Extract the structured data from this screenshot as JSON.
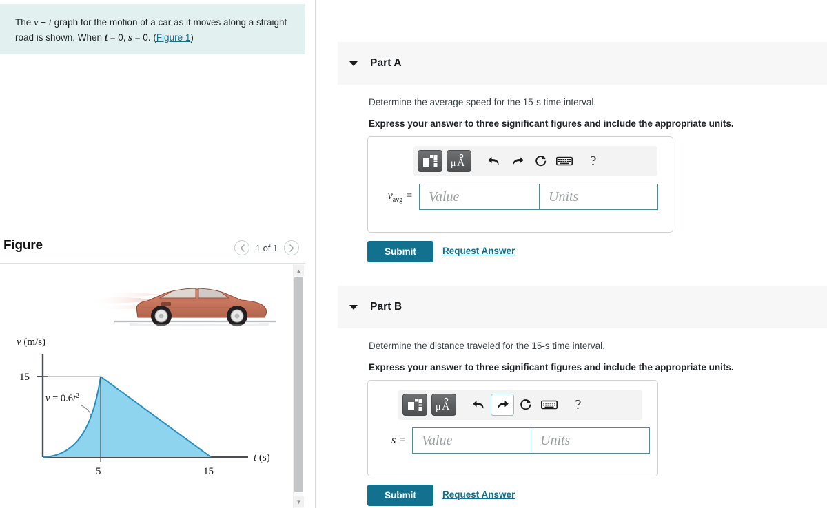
{
  "problem": {
    "text_pre": "The ",
    "v": "v",
    "dash": " − ",
    "t": "t",
    "text_mid": " graph for the motion of a car as it moves along a straight road is shown. When ",
    "t2": "t",
    "eq0a": " = 0, ",
    "s": "s",
    "eq0b": " = 0. ",
    "figure_link": "Figure 1",
    "full": "The v − t graph for the motion of a car as it moves along a straight road is shown. When t = 0, s = 0. (Figure 1)",
    "bg_color": "#e2f0ef",
    "link_color": "#1b6d8c"
  },
  "figure": {
    "title": "Figure",
    "count_label": "1 of 1",
    "prev_icon": "chevron-left-icon",
    "next_icon": "chevron-right-icon",
    "scroll_up_icon": "triangle-up-icon",
    "scroll_down_icon": "triangle-down-icon",
    "car_illustration": "red-sports-car-with-motion-blur"
  },
  "chart_data": {
    "type": "area",
    "title": "",
    "xlabel": "t (s)",
    "ylabel": "v (m/s)",
    "annotation": "v = 0.6t²",
    "xlim": [
      0,
      18
    ],
    "ylim": [
      0,
      18
    ],
    "xticks": [
      5,
      15
    ],
    "xtick_labels": [
      "5",
      "15"
    ],
    "yticks": [
      15
    ],
    "ytick_labels": [
      "15"
    ],
    "grid": false,
    "legend": null,
    "fill_color": "#8ed4ef",
    "line_color": "#2a8fbd",
    "segments": [
      {
        "name": "parabolic rise",
        "equation": "v = 0.6t^2",
        "t_from": 0,
        "t_to": 5,
        "v_from": 0,
        "v_to": 15
      },
      {
        "name": "linear fall",
        "equation": "v = 22.5 - 1.5t",
        "t_from": 5,
        "t_to": 15,
        "v_from": 15,
        "v_to": 0
      }
    ],
    "points": [
      {
        "t": 0,
        "v": 0
      },
      {
        "t": 1,
        "v": 0.6
      },
      {
        "t": 2,
        "v": 2.4
      },
      {
        "t": 3,
        "v": 5.4
      },
      {
        "t": 4,
        "v": 9.6
      },
      {
        "t": 5,
        "v": 15
      },
      {
        "t": 10,
        "v": 7.5
      },
      {
        "t": 15,
        "v": 0
      }
    ]
  },
  "parts": [
    {
      "id": "part-a",
      "title": "Part A",
      "caret_icon": "caret-down-icon",
      "question": "Determine the average speed for the 15-s time interval.",
      "instruction": "Express your answer to three significant figures and include the appropriate units.",
      "variable_label": "v",
      "variable_sub": "avg",
      "equals": "=",
      "value_placeholder": "Value",
      "units_placeholder": "Units",
      "value_text": "",
      "units_text": "",
      "submit_label": "Submit",
      "request_answer_label": "Request Answer",
      "toolbar": [
        {
          "name": "template-palette-icon",
          "style": "dark",
          "focused": false
        },
        {
          "name": "greek-units-icon",
          "style": "dark",
          "label": "μÅ",
          "focused": false
        },
        {
          "name": "undo-icon",
          "style": "plain",
          "focused": false
        },
        {
          "name": "redo-icon",
          "style": "plain",
          "focused": false
        },
        {
          "name": "reset-icon",
          "style": "plain",
          "focused": false
        },
        {
          "name": "keyboard-icon",
          "style": "plain",
          "focused": false
        },
        {
          "name": "help-icon",
          "style": "plain",
          "label": "?",
          "focused": false
        }
      ]
    },
    {
      "id": "part-b",
      "title": "Part B",
      "caret_icon": "caret-down-icon",
      "question": "Determine the distance traveled for the 15-s time interval.",
      "instruction": "Express your answer to three significant figures and include the appropriate units.",
      "variable_label": "s",
      "variable_sub": "",
      "equals": "=",
      "value_placeholder": "Value",
      "units_placeholder": "Units",
      "value_text": "",
      "units_text": "",
      "submit_label": "Submit",
      "request_answer_label": "Request Answer",
      "toolbar": [
        {
          "name": "template-palette-icon",
          "style": "dark",
          "focused": false
        },
        {
          "name": "greek-units-icon",
          "style": "dark",
          "label": "μÅ",
          "focused": false
        },
        {
          "name": "undo-icon",
          "style": "plain",
          "focused": false
        },
        {
          "name": "redo-icon",
          "style": "plain",
          "focused": true
        },
        {
          "name": "reset-icon",
          "style": "plain",
          "focused": false
        },
        {
          "name": "keyboard-icon",
          "style": "plain",
          "focused": false
        },
        {
          "name": "help-icon",
          "style": "plain",
          "label": "?",
          "focused": false
        }
      ]
    }
  ],
  "colors": {
    "accent": "#12718f",
    "part_header_bg": "#f7f7f7",
    "problem_bg": "#e2f0ef",
    "input_border": "#4b8b9c",
    "chart_fill": "#8ed4ef",
    "chart_line": "#2a8fbd"
  }
}
